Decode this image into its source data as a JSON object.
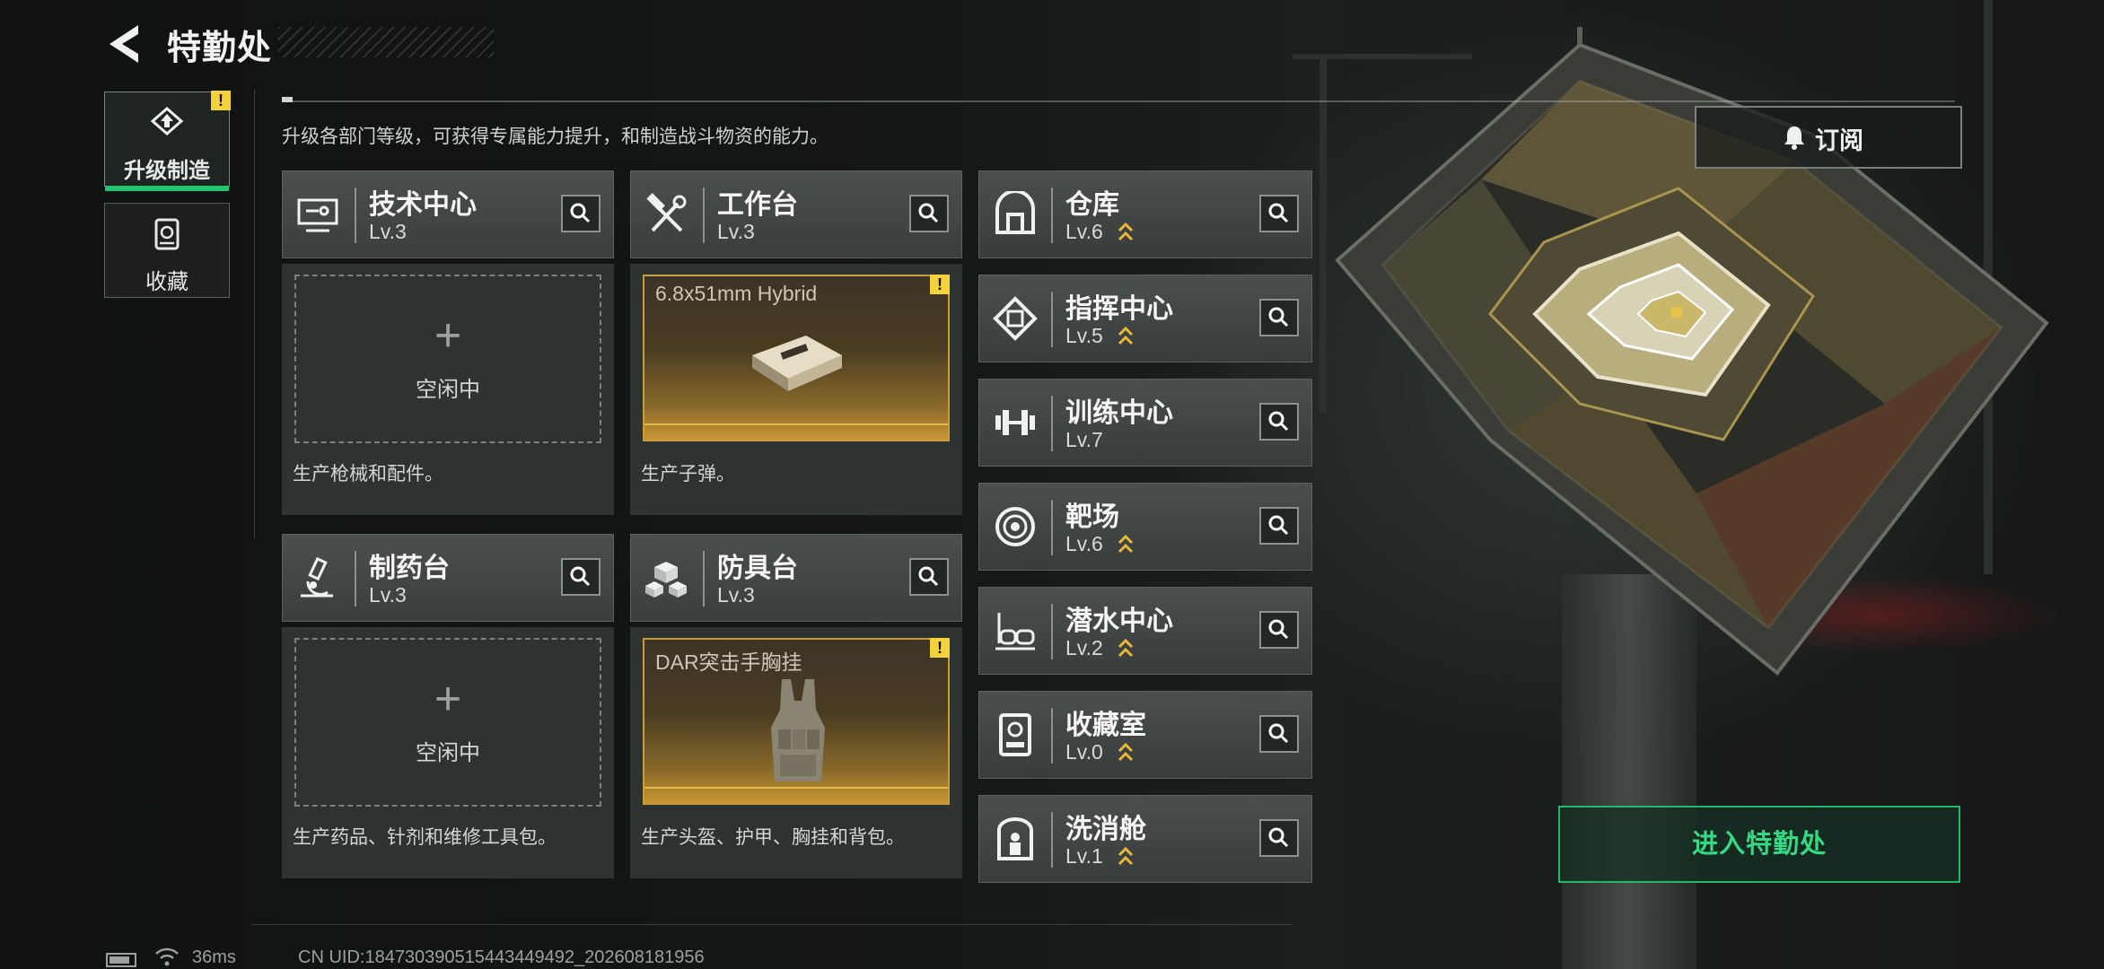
{
  "header": {
    "title": "特勤处"
  },
  "tabs": [
    {
      "label": "升级制造",
      "active": true,
      "alert": "!"
    },
    {
      "label": "收藏",
      "active": false
    }
  ],
  "description": "升级各部门等级，可获得专属能力提升，和制造战斗物资的能力。",
  "subscribe_label": "订阅",
  "workstations": [
    {
      "name": "技术中心",
      "level": "Lv.3",
      "icon": "monitor-icon",
      "status": "空闲中",
      "product": null,
      "desc": "生产枪械和配件。"
    },
    {
      "name": "工作台",
      "level": "Lv.3",
      "icon": "hammer-wrench-icon",
      "status": null,
      "product": "6.8x51mm Hybrid",
      "alert": "!",
      "desc": "生产子弹。"
    },
    {
      "name": "制药台",
      "level": "Lv.3",
      "icon": "microscope-icon",
      "status": "空闲中",
      "product": null,
      "desc": "生产药品、针剂和维修工具包。"
    },
    {
      "name": "防具台",
      "level": "Lv.3",
      "icon": "blocks-icon",
      "status": null,
      "product": "DAR突击手胸挂",
      "alert": "!",
      "desc": "生产头盔、护甲、胸挂和背包。"
    }
  ],
  "facilities": [
    {
      "name": "仓库",
      "level": "Lv.6",
      "upgradable": true,
      "icon": "warehouse-icon"
    },
    {
      "name": "指挥中心",
      "level": "Lv.5",
      "upgradable": true,
      "icon": "command-chip-icon"
    },
    {
      "name": "训练中心",
      "level": "Lv.7",
      "upgradable": false,
      "icon": "dumbbell-icon"
    },
    {
      "name": "靶场",
      "level": "Lv.6",
      "upgradable": true,
      "icon": "target-icon"
    },
    {
      "name": "潜水中心",
      "level": "Lv.2",
      "upgradable": true,
      "icon": "diving-mask-icon"
    },
    {
      "name": "收藏室",
      "level": "Lv.0",
      "upgradable": true,
      "icon": "trophy-case-icon"
    },
    {
      "name": "洗消舱",
      "level": "Lv.1",
      "upgradable": true,
      "icon": "decon-chamber-icon"
    }
  ],
  "enter_button": "进入特勤处",
  "status_bar": {
    "ping": "36ms",
    "uid": "CN UID:18473039051544344949​2_202608181956"
  },
  "colors": {
    "accent_green": "#21c56e",
    "alert_yellow": "#f3d23b",
    "gold": "#c89c3a",
    "upgrade_gold": "#e9b93c"
  }
}
